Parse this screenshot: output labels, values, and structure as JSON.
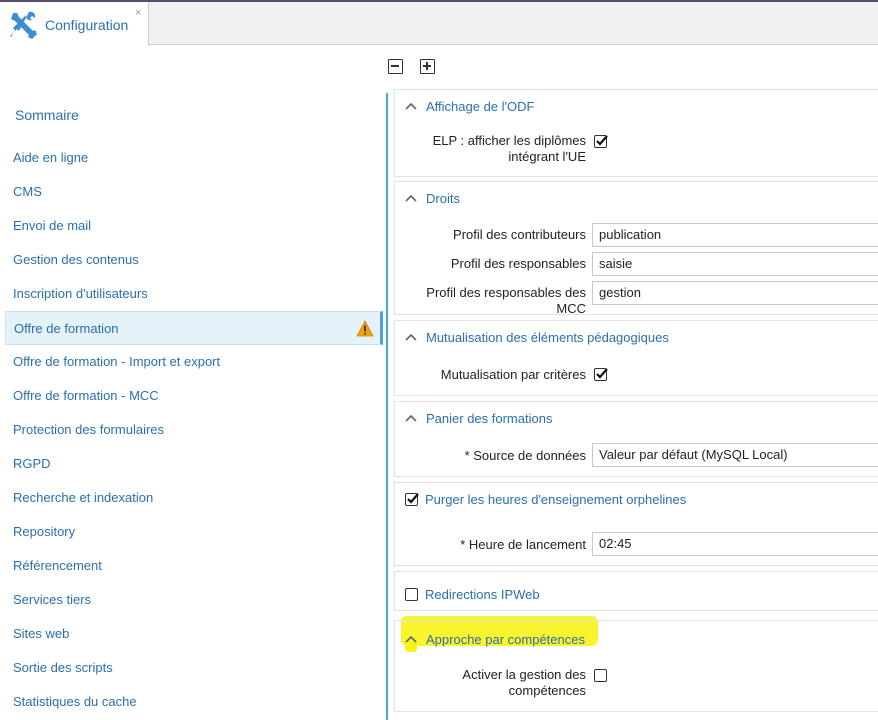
{
  "tab": {
    "label": "Configuration",
    "close": "×"
  },
  "toolbar": {
    "collapse_icon": "minus-square-icon",
    "expand_icon": "plus-square-icon"
  },
  "sidebar": {
    "title": "Sommaire",
    "items": [
      {
        "label": "Aide en ligne"
      },
      {
        "label": "CMS"
      },
      {
        "label": "Envoi de mail"
      },
      {
        "label": "Gestion des contenus"
      },
      {
        "label": "Inscription d'utilisateurs"
      },
      {
        "label": "Offre de formation",
        "active": true,
        "warning": true
      },
      {
        "label": "Offre de formation - Import et export"
      },
      {
        "label": "Offre de formation - MCC"
      },
      {
        "label": "Protection des formulaires"
      },
      {
        "label": "RGPD"
      },
      {
        "label": "Recherche et indexation"
      },
      {
        "label": "Repository"
      },
      {
        "label": "Référencement"
      },
      {
        "label": "Services tiers"
      },
      {
        "label": "Sites web"
      },
      {
        "label": "Sortie des scripts"
      },
      {
        "label": "Statistiques du cache"
      }
    ]
  },
  "panels": {
    "affichage": {
      "title": "Affichage de l'ODF",
      "elp_label_1": "ELP : afficher les diplômes",
      "elp_label_2": "intégrant l'UE",
      "elp_checked": true
    },
    "droits": {
      "title": "Droits",
      "contrib_label": "Profil des contributeurs",
      "contrib_value": "publication",
      "resp_label": "Profil des responsables",
      "resp_value": "saisie",
      "mcc_label": "Profil des responsables des MCC",
      "mcc_value": "gestion"
    },
    "mutualisation": {
      "title": "Mutualisation des éléments pédagogiques",
      "crit_label": "Mutualisation par critères",
      "crit_checked": true
    },
    "panier": {
      "title": "Panier des formations",
      "source_label": "* Source de données",
      "source_value": "Valeur par défaut (MySQL Local)"
    },
    "purger": {
      "title": "Purger les heures d'enseignement orphelines",
      "checked": true,
      "heure_label": "* Heure de lancement",
      "heure_value": "02:45"
    },
    "redirections": {
      "title": "Redirections IPWeb",
      "checked": false
    },
    "approche": {
      "title": "Approche par compétences",
      "activer_label_1": "Activer la gestion des",
      "activer_label_2": "compétences",
      "activer_checked": false
    }
  },
  "colors": {
    "accent": "#2a6fb0",
    "active_bg": "#e4f2fa",
    "highlight": "#f7f417",
    "warning": "#f0a30a"
  }
}
